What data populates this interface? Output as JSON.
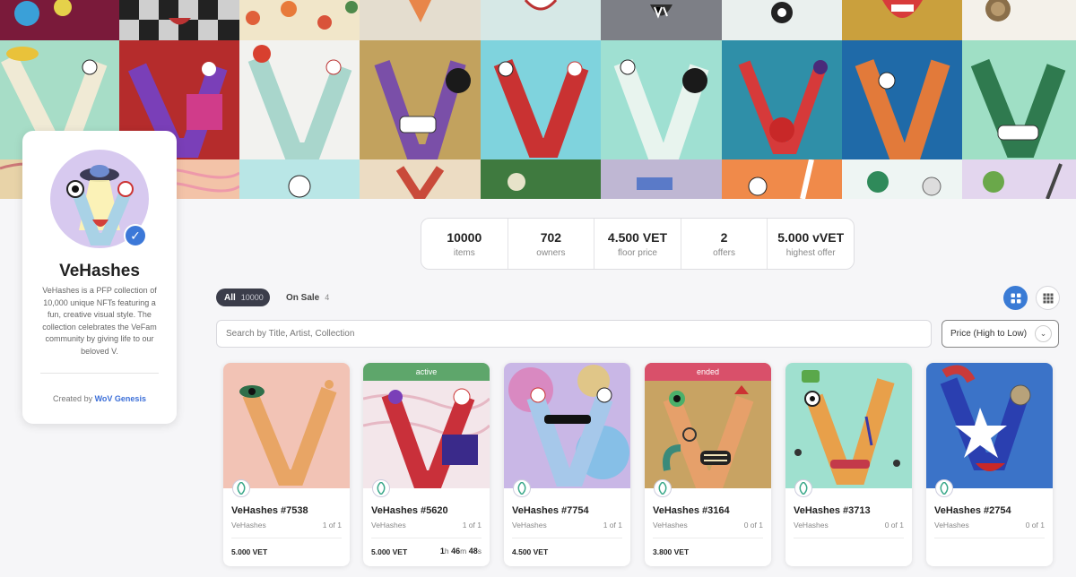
{
  "collection": {
    "name": "VeHashes",
    "description": "VeHashes is a PFP collection of 10,000 unique NFTs featuring a fun, creative visual style. The collection celebrates the VeFam community by giving life to our beloved V.",
    "created_by_label": "Created by",
    "creator": "WoV Genesis"
  },
  "stats": [
    {
      "value": "10000",
      "label": "items"
    },
    {
      "value": "702",
      "label": "owners"
    },
    {
      "value": "4.500 VET",
      "label": "floor price"
    },
    {
      "value": "2",
      "label": "offers"
    },
    {
      "value": "5.000 vVET",
      "label": "highest offer"
    }
  ],
  "filters": {
    "all_label": "All",
    "all_count": "10000",
    "on_sale_label": "On Sale",
    "on_sale_count": "4"
  },
  "search": {
    "placeholder": "Search by Title, Artist, Collection"
  },
  "sort": {
    "selected": "Price (High to Low)"
  },
  "cards": [
    {
      "name": "VeHashes #7538",
      "collection": "VeHashes",
      "edition": "1 of 1",
      "price": "5.000 VET",
      "status": "",
      "timer": null
    },
    {
      "name": "VeHashes #5620",
      "collection": "VeHashes",
      "edition": "1 of 1",
      "price": "5.000 VET",
      "status": "active",
      "timer": {
        "h": "1",
        "h_unit": "h",
        "m": "46",
        "m_unit": "m",
        "s": "48",
        "s_unit": "s"
      }
    },
    {
      "name": "VeHashes #7754",
      "collection": "VeHashes",
      "edition": "1 of 1",
      "price": "4.500 VET",
      "status": "",
      "timer": null
    },
    {
      "name": "VeHashes #3164",
      "collection": "VeHashes",
      "edition": "0 of 1",
      "price": "3.800 VET",
      "status": "ended",
      "timer": null
    },
    {
      "name": "VeHashes #3713",
      "collection": "VeHashes",
      "edition": "0 of 1",
      "price": "",
      "status": "",
      "timer": null
    },
    {
      "name": "VeHashes #2754",
      "collection": "VeHashes",
      "edition": "0 of 1",
      "price": "",
      "status": "",
      "timer": null
    }
  ],
  "colors": {
    "accent": "#3a7bd5",
    "status_active": "#5ea66b",
    "status_ended": "#d9506a",
    "tab_dark": "#3b3d4a"
  }
}
